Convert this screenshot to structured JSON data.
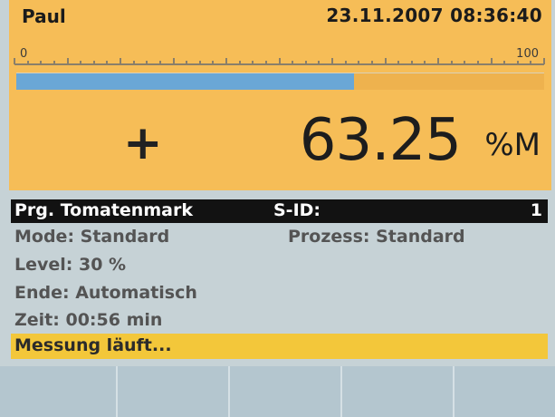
{
  "header": {
    "user": "Paul",
    "datetime": "23.11.2007 08:36:40"
  },
  "scale": {
    "min_label": "0",
    "max_label": "100"
  },
  "progress": {
    "percent": 64,
    "fill_color": "#6aa7d6"
  },
  "measurement": {
    "sign": "+",
    "value": "63.25",
    "unit": "%M"
  },
  "info": {
    "program": "Prg. Tomatenmark",
    "sid_label": "S-ID:",
    "sid_value": "1",
    "mode": "Mode: Standard",
    "prozess": "Prozess: Standard",
    "level": "Level: 30 %",
    "ende": "Ende: Automatisch",
    "zeit": "Zeit: 00:56 min"
  },
  "status": {
    "text": "Messung läuft..."
  },
  "colors": {
    "panel_orange": "#f6bd57",
    "status_yellow": "#f3c73a",
    "background": "#c6d2d6"
  }
}
